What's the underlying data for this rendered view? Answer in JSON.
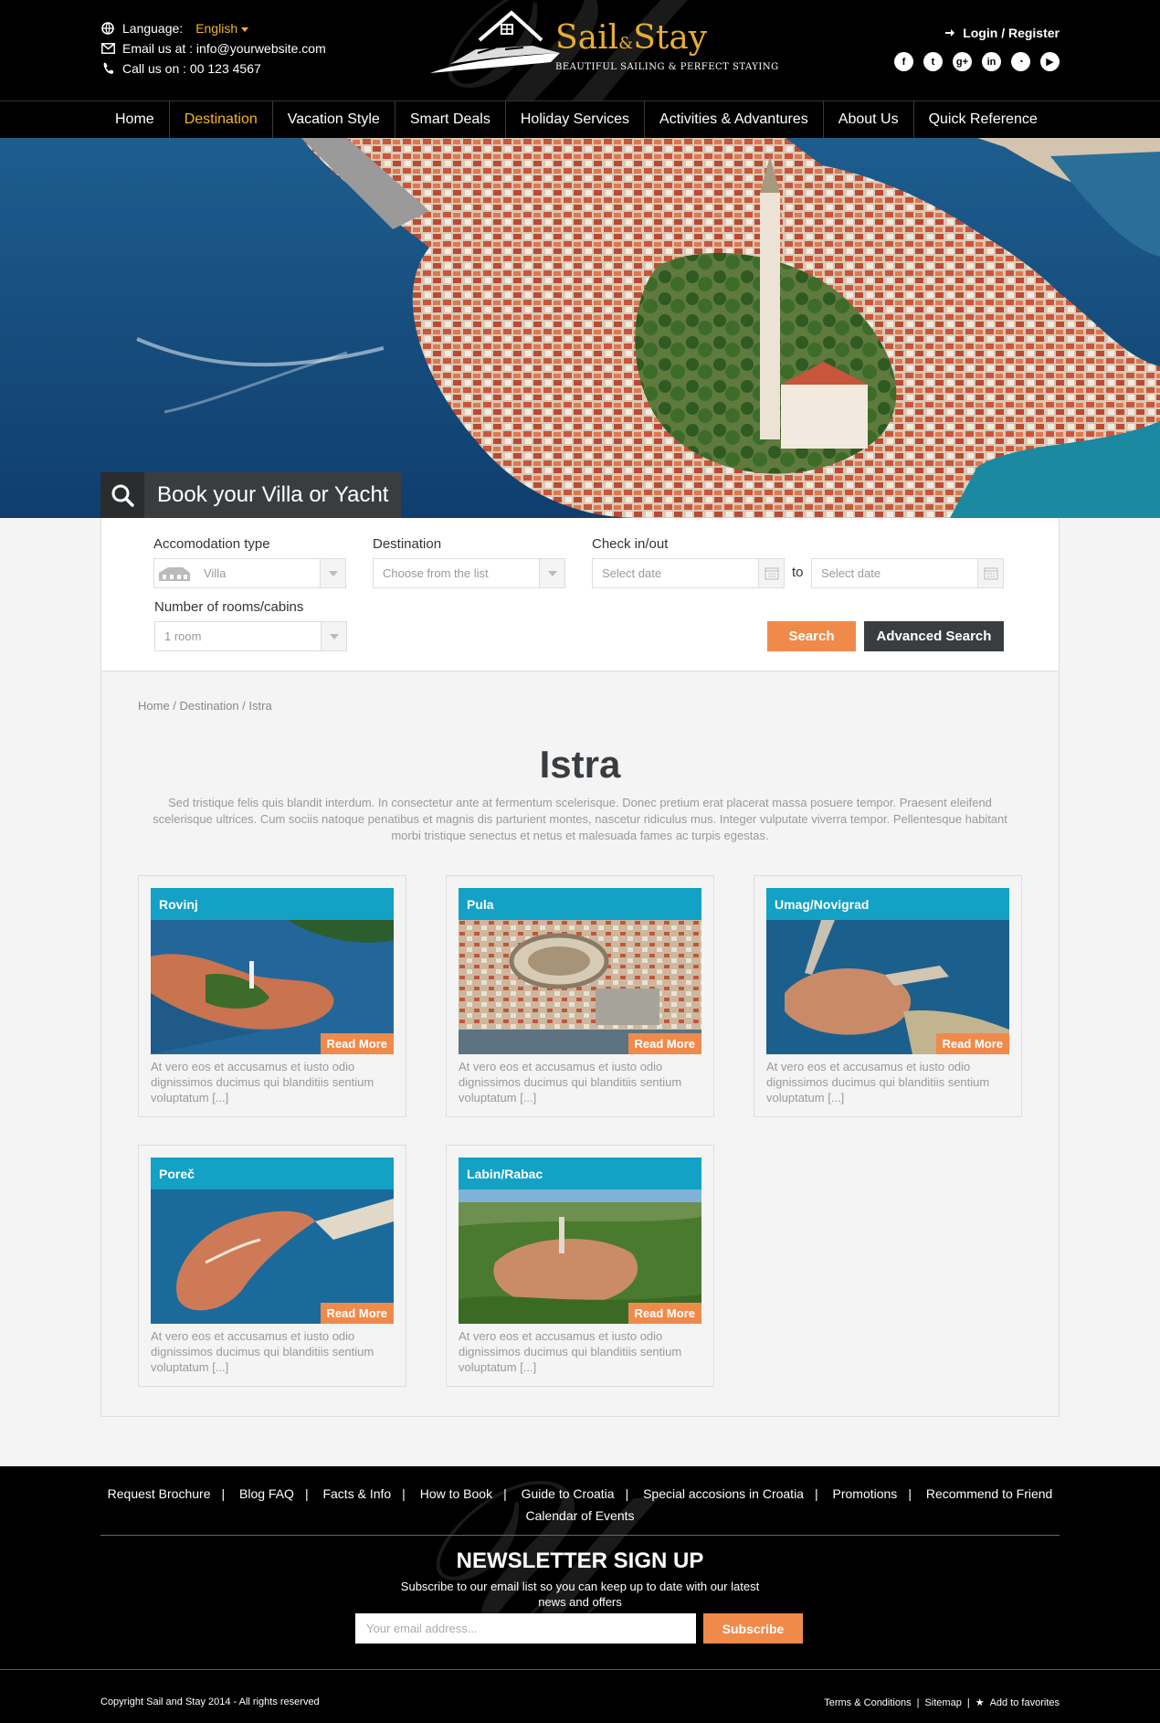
{
  "header": {
    "language_label": "Language:",
    "language_value": "English",
    "email": "Email us at : info@yourwebsite.com",
    "phone": "Call us on : 00 123 4567",
    "logo_title_1": "Sail",
    "logo_amp": "&",
    "logo_title_2": "Stay",
    "logo_subtitle": "BEAUTIFUL SAILING & PERFECT STAYING",
    "login": "Login / Register",
    "socials": [
      "facebook",
      "twitter",
      "google-plus",
      "linkedin",
      "rss",
      "youtube"
    ]
  },
  "nav": {
    "items": [
      "Home",
      "Destination",
      "Vacation Style",
      "Smart Deals",
      "Holiday Services",
      "Activities & Advantures",
      "About Us",
      "Quick Reference"
    ],
    "active": "Destination"
  },
  "hero": {
    "book_title": "Book your Villa or Yacht"
  },
  "booking": {
    "accom_label": "Accomodation type",
    "accom_value": "Villa",
    "dest_label": "Destination",
    "dest_value": "Choose from the list",
    "check_label": "Check in/out",
    "check_in": "Select date",
    "to": "to",
    "check_out": "Select date",
    "rooms_label": "Number of rooms/cabins",
    "rooms_value": "1 room",
    "search": "Search",
    "advanced": "Advanced Search"
  },
  "main": {
    "breadcrumb": "Home / Destination / Istra",
    "title": "Istra",
    "intro": "Sed tristique felis quis blandit interdum. In consectetur ante at fermentum scelerisque. Donec pretium erat placerat massa posuere tempor. Praesent eleifend scelerisque ultrices. Cum sociis natoque penatibus et magnis dis parturient montes, nascetur ridiculus mus. Integer vulputate viverra tempor. Pellentesque habitant morbi tristique senectus et netus et malesuada fames ac turpis egestas.",
    "read_more": "Read More",
    "cards": [
      {
        "title": "Rovinj",
        "desc": "At vero eos et accusamus et iusto odio dignissimos ducimus qui blanditiis sentium voluptatum [...]"
      },
      {
        "title": "Pula",
        "desc": "At vero eos et accusamus et iusto odio dignissimos ducimus qui blanditiis sentium voluptatum [...]"
      },
      {
        "title": "Umag/Novigrad",
        "desc": "At vero eos et accusamus et iusto odio dignissimos ducimus qui blanditiis sentium voluptatum [...]"
      },
      {
        "title": "Poreč",
        "desc": "At vero eos et accusamus et iusto odio dignissimos ducimus qui blanditiis sentium voluptatum [...]"
      },
      {
        "title": "Labin/Rabac",
        "desc": "At vero eos et accusamus et iusto odio dignissimos ducimus qui blanditiis sentium voluptatum [...]"
      }
    ]
  },
  "footer": {
    "links": [
      "Request Brochure",
      "Blog FAQ",
      "Facts & Info",
      "How to Book",
      "Guide to Croatia",
      "Special accosions in Croatia",
      "Promotions",
      "Recommend to Friend"
    ],
    "links_row2": "Calendar of Events",
    "newsletter_title": "NEWSLETTER SIGN UP",
    "newsletter_sub": "Subscribe to our email list so you can keep up to date with our latest",
    "newsletter_sub2": "news and offers",
    "email_placeholder": "Your email address...",
    "subscribe": "Subscribe",
    "copyright": "Copyright Sail and Stay 2014 - All rights reserved",
    "terms": "Terms & Conditions",
    "sitemap": "Sitemap",
    "favorites": "Add to favorites"
  },
  "colors": {
    "accent_gold": "#f0b42a",
    "accent_orange": "#f08a4b",
    "card_title_blue": "#13a1c6",
    "dark": "#3a3d40"
  }
}
